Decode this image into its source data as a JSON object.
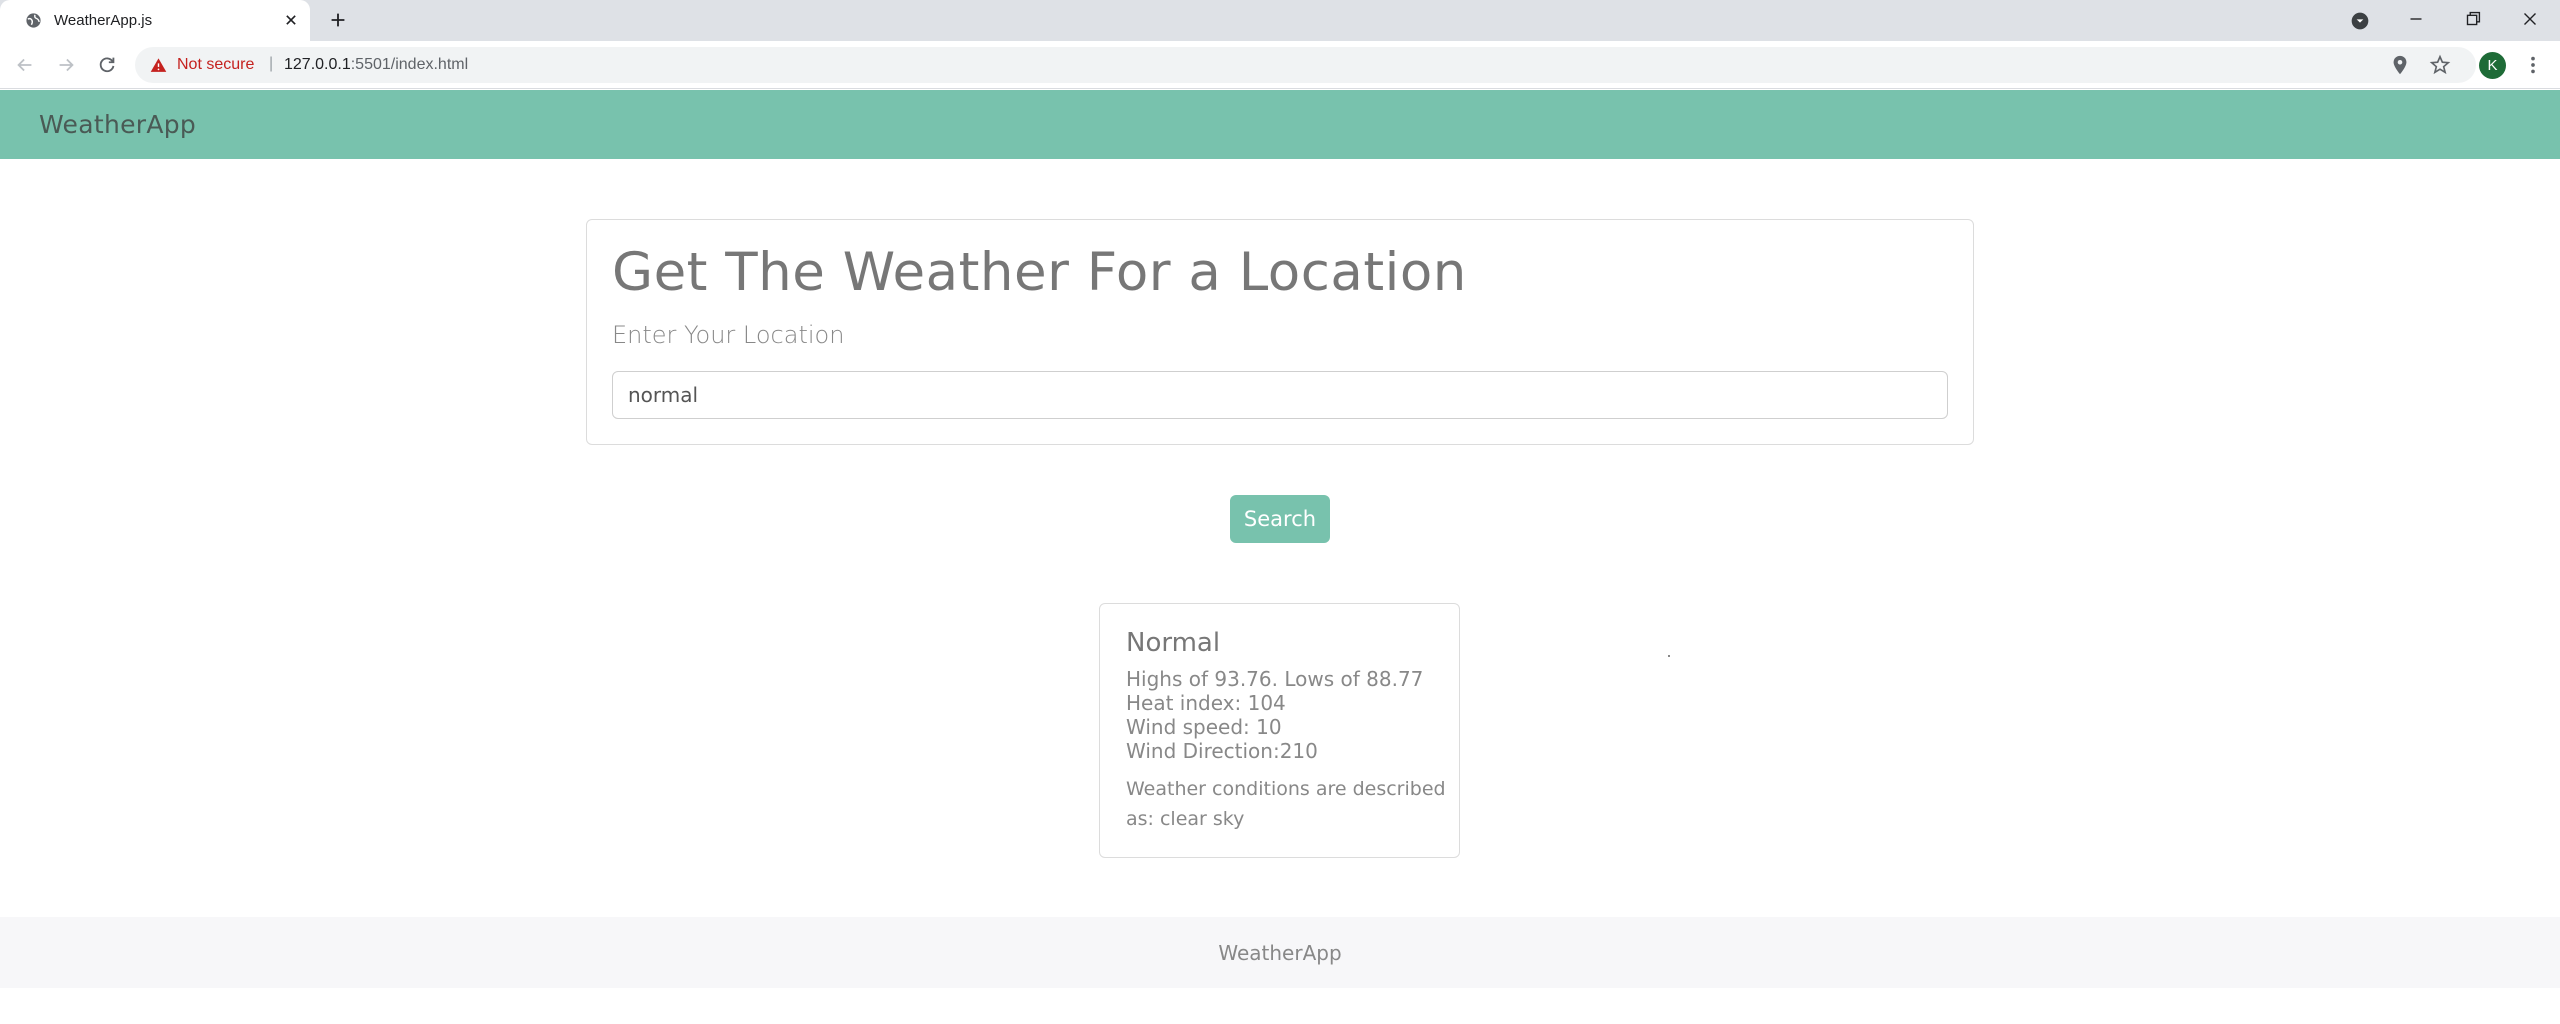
{
  "browser": {
    "tab_title": "WeatherApp.js",
    "security_label": "Not secure",
    "separator": "|",
    "url_host": "127.0.0.1",
    "url_path": ":5501/index.html",
    "profile_initial": "K"
  },
  "navbar": {
    "brand": "WeatherApp"
  },
  "search": {
    "heading": "Get The Weather For a Location",
    "subheading": "Enter Your Location",
    "input_value": "normal",
    "button_label": "Search"
  },
  "result": {
    "title": "Normal",
    "highs_lows": "Highs of 93.76. Lows of 88.77",
    "heat_index": "Heat index: 104",
    "wind_speed": "Wind speed: 10",
    "wind_direction": "Wind Direction:210",
    "description": "Weather conditions are described as: clear sky"
  },
  "footer": {
    "text": "WeatherApp"
  },
  "colors": {
    "primary": "#78c2ad",
    "warning": "#c5221f",
    "avatar": "#1e6b37"
  }
}
